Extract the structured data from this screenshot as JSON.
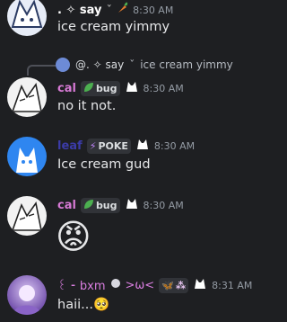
{
  "messages": [
    {
      "author": ". ✧ say",
      "suffix": "ˇ",
      "time": "8:30 AM",
      "content": "ice cream yimmy"
    },
    {
      "reply": {
        "author": "@. ✧ say",
        "suffix": "ˇ",
        "content": "ice cream yimmy"
      },
      "author": "cal",
      "tag": "bug",
      "time": "8:30 AM",
      "content": "no it not."
    },
    {
      "author": "leaf",
      "tag": "POKE",
      "time": "8:30 AM",
      "content": "Ice cream gud"
    },
    {
      "author": "cal",
      "tag": "bug",
      "time": "8:30 AM",
      "content": "😡"
    },
    {
      "author": "꒰ ⁃ bxm",
      "emote": ">ω<",
      "time": "8:31 AM",
      "content": "haii...🥺"
    }
  ],
  "colors": {
    "background": "#1e1f22",
    "cal_name": "#d77ad5",
    "leaf_name": "#3b3ba8",
    "bxm_name": "#d97ee0",
    "timestamp": "#949ba4",
    "text": "#e6e7e9"
  }
}
